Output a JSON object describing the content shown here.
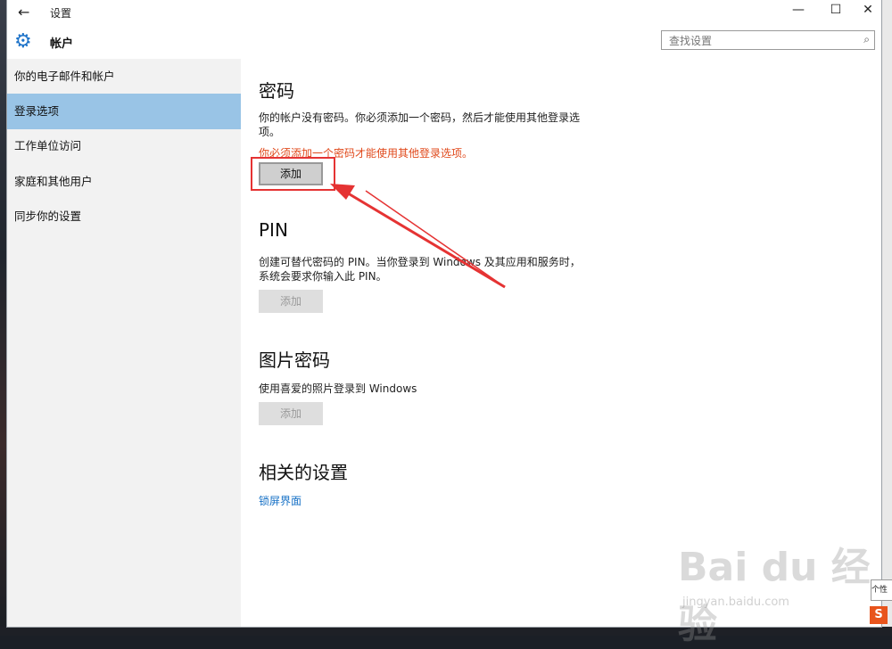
{
  "window": {
    "back_icon": "←",
    "title": "设置",
    "minimize": "—",
    "maximize": "☐",
    "close": "✕"
  },
  "header": {
    "section_title": "帐户",
    "search_placeholder": "查找设置"
  },
  "sidebar": {
    "items": [
      {
        "label": "你的电子邮件和帐户"
      },
      {
        "label": "登录选项"
      },
      {
        "label": "工作单位访问"
      },
      {
        "label": "家庭和其他用户"
      },
      {
        "label": "同步你的设置"
      }
    ],
    "selected": "登录选项"
  },
  "content": {
    "password": {
      "heading": "密码",
      "description": "你的帐户没有密码。你必须添加一个密码，然后才能使用其他登录选项。",
      "warning": "你必须添加一个密码才能使用其他登录选项。",
      "button": "添加"
    },
    "pin": {
      "heading": "PIN",
      "description": "创建可替代密码的 PIN。当你登录到 Windows 及其应用和服务时，系统会要求你输入此 PIN。",
      "button": "添加"
    },
    "picture": {
      "heading": "图片密码",
      "description": "使用喜爱的照片登录到 Windows",
      "button": "添加"
    },
    "related": {
      "heading": "相关的设置",
      "link": "锁屏界面"
    }
  },
  "watermark": {
    "brand": "Bai du 经验",
    "url": "jingyan.baidu.com"
  },
  "tray": {
    "tooltip": "个性",
    "ime": "S"
  },
  "colors": {
    "accent": "#1e73c9",
    "selected_nav": "#99c4e6",
    "warning": "#e0491b",
    "annotation": "#e53333",
    "link": "#1771c6"
  }
}
